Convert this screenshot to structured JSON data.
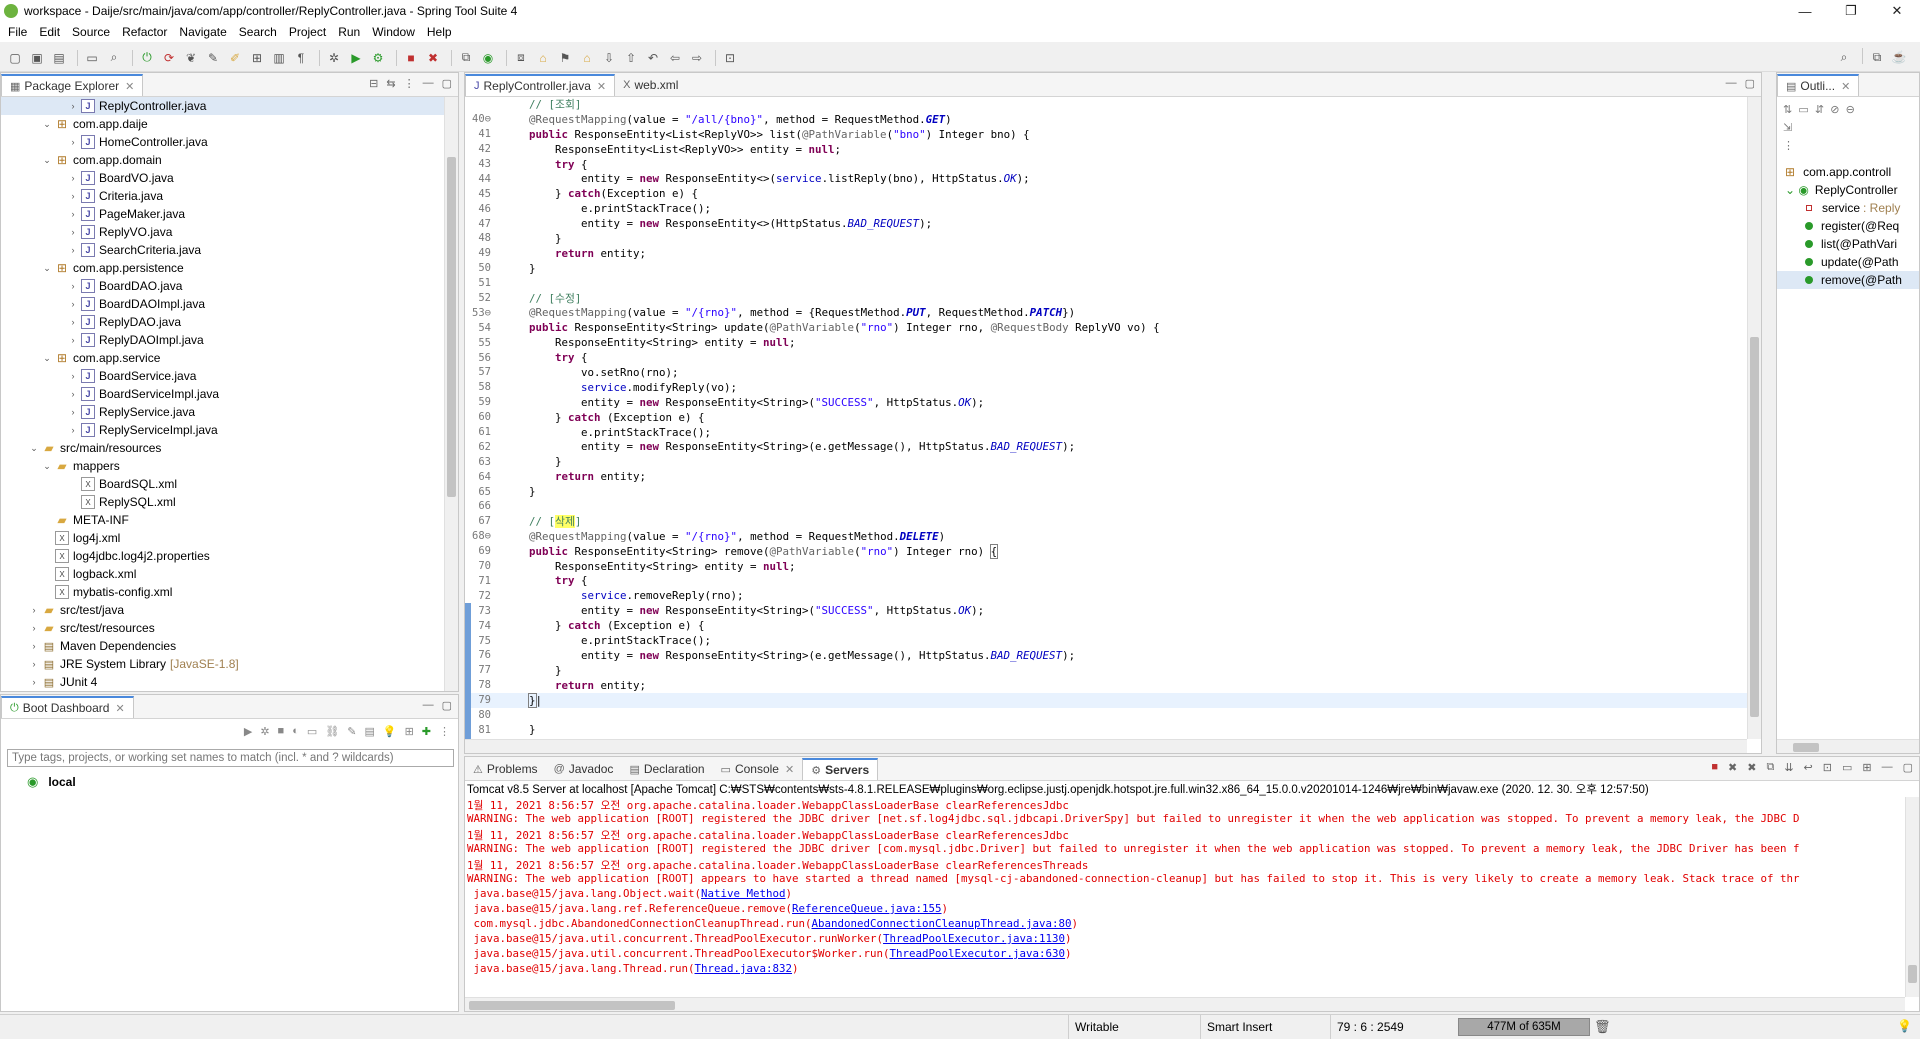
{
  "window": {
    "title": "workspace - Daije/src/main/java/com/app/controller/ReplyController.java - Spring Tool Suite 4",
    "controls": [
      "—",
      "❐",
      "✕"
    ]
  },
  "menu": [
    "File",
    "Edit",
    "Source",
    "Refactor",
    "Navigate",
    "Search",
    "Project",
    "Run",
    "Window",
    "Help"
  ],
  "package_explorer": {
    "tab": "Package Explorer",
    "rows": [
      {
        "indent": 4,
        "arrow": "›",
        "icon": "java",
        "label": "ReplyController.java",
        "selected": true
      },
      {
        "indent": 2,
        "arrow": "⌄",
        "icon": "pkg",
        "label": "com.app.daije"
      },
      {
        "indent": 4,
        "arrow": "›",
        "icon": "java",
        "label": "HomeController.java"
      },
      {
        "indent": 2,
        "arrow": "⌄",
        "icon": "pkg",
        "label": "com.app.domain"
      },
      {
        "indent": 4,
        "arrow": "›",
        "icon": "java",
        "label": "BoardVO.java"
      },
      {
        "indent": 4,
        "arrow": "›",
        "icon": "java",
        "label": "Criteria.java"
      },
      {
        "indent": 4,
        "arrow": "›",
        "icon": "java",
        "label": "PageMaker.java"
      },
      {
        "indent": 4,
        "arrow": "›",
        "icon": "java",
        "label": "ReplyVO.java"
      },
      {
        "indent": 4,
        "arrow": "›",
        "icon": "java",
        "label": "SearchCriteria.java"
      },
      {
        "indent": 2,
        "arrow": "⌄",
        "icon": "pkg",
        "label": "com.app.persistence"
      },
      {
        "indent": 4,
        "arrow": "›",
        "icon": "java",
        "label": "BoardDAO.java"
      },
      {
        "indent": 4,
        "arrow": "›",
        "icon": "java",
        "label": "BoardDAOImpl.java"
      },
      {
        "indent": 4,
        "arrow": "›",
        "icon": "java",
        "label": "ReplyDAO.java"
      },
      {
        "indent": 4,
        "arrow": "›",
        "icon": "java",
        "label": "ReplyDAOImpl.java"
      },
      {
        "indent": 2,
        "arrow": "⌄",
        "icon": "pkg",
        "label": "com.app.service"
      },
      {
        "indent": 4,
        "arrow": "›",
        "icon": "java",
        "label": "BoardService.java"
      },
      {
        "indent": 4,
        "arrow": "›",
        "icon": "java",
        "label": "BoardServiceImpl.java"
      },
      {
        "indent": 4,
        "arrow": "›",
        "icon": "java",
        "label": "ReplyService.java"
      },
      {
        "indent": 4,
        "arrow": "›",
        "icon": "java",
        "label": "ReplyServiceImpl.java"
      },
      {
        "indent": 1,
        "arrow": "⌄",
        "icon": "folder",
        "label": "src/main/resources"
      },
      {
        "indent": 2,
        "arrow": "⌄",
        "icon": "folder",
        "label": "mappers"
      },
      {
        "indent": 4,
        "arrow": "",
        "icon": "xml",
        "label": "BoardSQL.xml"
      },
      {
        "indent": 4,
        "arrow": "",
        "icon": "xml",
        "label": "ReplySQL.xml"
      },
      {
        "indent": 2,
        "arrow": "",
        "icon": "folder",
        "label": "META-INF"
      },
      {
        "indent": 2,
        "arrow": "",
        "icon": "xml",
        "label": "log4j.xml"
      },
      {
        "indent": 2,
        "arrow": "",
        "icon": "xml",
        "label": "log4jdbc.log4j2.properties"
      },
      {
        "indent": 2,
        "arrow": "",
        "icon": "xml",
        "label": "logback.xml"
      },
      {
        "indent": 2,
        "arrow": "",
        "icon": "xml",
        "label": "mybatis-config.xml"
      },
      {
        "indent": 1,
        "arrow": "›",
        "icon": "folder",
        "label": "src/test/java"
      },
      {
        "indent": 1,
        "arrow": "›",
        "icon": "folder",
        "label": "src/test/resources"
      },
      {
        "indent": 1,
        "arrow": "›",
        "icon": "lib",
        "label": "Maven Dependencies"
      },
      {
        "indent": 1,
        "arrow": "›",
        "icon": "lib",
        "label": "JRE System Library",
        "suffix": "[JavaSE-1.8]"
      },
      {
        "indent": 1,
        "arrow": "›",
        "icon": "lib",
        "label": "JUnit 4"
      }
    ]
  },
  "boot_dashboard": {
    "tab": "Boot Dashboard",
    "filter_placeholder": "Type tags, projects, or working set names to match (incl. * and ? wildcards)",
    "item": "local"
  },
  "editor": {
    "tabs": [
      "ReplyController.java",
      "web.xml"
    ],
    "lines": [
      {
        "n": "",
        "html": "<span class='cmt'>// [조회]</span>"
      },
      {
        "n": "40⊖",
        "html": "<span class='ann'>@RequestMapping</span>(value = <span class='str'>\"/all/{bno}\"</span>, method = RequestMethod.<span class='itl'><b>GET</b></span>)"
      },
      {
        "n": "41",
        "html": "<span class='kw'>public</span> ResponseEntity&lt;List&lt;ReplyVO&gt;&gt; list(<span class='ann'>@PathVariable</span>(<span class='str'>\"bno\"</span>) Integer bno) {"
      },
      {
        "n": "42",
        "html": "    ResponseEntity&lt;List&lt;ReplyVO&gt;&gt; entity = <span class='kw'>null</span>;"
      },
      {
        "n": "43",
        "html": "    <span class='kw'>try</span> {"
      },
      {
        "n": "44",
        "html": "        entity = <span class='kw'>new</span> ResponseEntity&lt;&gt;(<span class='fld'>service</span>.listReply(bno), HttpStatus.<span class='itl'>OK</span>);"
      },
      {
        "n": "45",
        "html": "    } <span class='kw'>catch</span>(Exception e) {"
      },
      {
        "n": "46",
        "html": "        e.printStackTrace();"
      },
      {
        "n": "47",
        "html": "        entity = <span class='kw'>new</span> ResponseEntity&lt;&gt;(HttpStatus.<span class='itl'>BAD_REQUEST</span>);"
      },
      {
        "n": "48",
        "html": "    }"
      },
      {
        "n": "49",
        "html": "    <span class='kw'>return</span> entity;"
      },
      {
        "n": "50",
        "html": "}"
      },
      {
        "n": "51",
        "html": ""
      },
      {
        "n": "52",
        "html": "<span class='cmt'>// [수정]</span>"
      },
      {
        "n": "53⊖",
        "html": "<span class='ann'>@RequestMapping</span>(value = <span class='str'>\"/{rno}\"</span>, method = {RequestMethod.<span class='itl'><b>PUT</b></span>, RequestMethod.<span class='itl'><b>PATCH</b></span>})"
      },
      {
        "n": "54",
        "html": "<span class='kw'>public</span> ResponseEntity&lt;String&gt; update(<span class='ann'>@PathVariable</span>(<span class='str'>\"rno\"</span>) Integer rno, <span class='ann'>@RequestBody</span> ReplyVO vo) {"
      },
      {
        "n": "55",
        "html": "    ResponseEntity&lt;String&gt; entity = <span class='kw'>null</span>;"
      },
      {
        "n": "56",
        "html": "    <span class='kw'>try</span> {"
      },
      {
        "n": "57",
        "html": "        vo.setRno(rno);"
      },
      {
        "n": "58",
        "html": "        <span class='fld'>service</span>.modifyReply(vo);"
      },
      {
        "n": "59",
        "html": "        entity = <span class='kw'>new</span> ResponseEntity&lt;String&gt;(<span class='str'>\"SUCCESS\"</span>, HttpStatus.<span class='itl'>OK</span>);"
      },
      {
        "n": "60",
        "html": "    } <span class='kw'>catch</span> (Exception e) {"
      },
      {
        "n": "61",
        "html": "        e.printStackTrace();"
      },
      {
        "n": "62",
        "html": "        entity = <span class='kw'>new</span> ResponseEntity&lt;String&gt;(e.getMessage(), HttpStatus.<span class='itl'>BAD_REQUEST</span>);"
      },
      {
        "n": "63",
        "html": "    }"
      },
      {
        "n": "64",
        "html": "    <span class='kw'>return</span> entity;"
      },
      {
        "n": "65",
        "html": "}"
      },
      {
        "n": "66",
        "html": ""
      },
      {
        "n": "67",
        "html": "<span class='cmt'>// [<span class='hl'>삭제</span>]</span>"
      },
      {
        "n": "68⊖",
        "html": "<span class='ann'>@RequestMapping</span>(value = <span class='str'>\"/{rno}\"</span>, method = RequestMethod.<span class='itl'><b>DELETE</b></span>)"
      },
      {
        "n": "69",
        "html": "<span class='kw'>public</span> ResponseEntity&lt;String&gt; remove(<span class='ann'>@PathVariable</span>(<span class='str'>\"rno\"</span>) Integer rno) <span style='outline:1px solid #808080'>{</span>"
      },
      {
        "n": "70",
        "html": "    ResponseEntity&lt;String&gt; entity = <span class='kw'>null</span>;"
      },
      {
        "n": "71",
        "html": "    <span class='kw'>try</span> {"
      },
      {
        "n": "72",
        "html": "        <span class='fld'>service</span>.removeReply(rno);"
      },
      {
        "n": "73",
        "html": "        entity = <span class='kw'>new</span> ResponseEntity&lt;String&gt;(<span class='str'>\"SUCCESS\"</span>, HttpStatus.<span class='itl'>OK</span>);"
      },
      {
        "n": "74",
        "html": "    } <span class='kw'>catch</span> (Exception e) {"
      },
      {
        "n": "75",
        "html": "        e.printStackTrace();"
      },
      {
        "n": "76",
        "html": "        entity = <span class='kw'>new</span> ResponseEntity&lt;String&gt;(e.getMessage(), HttpStatus.<span class='itl'>BAD_REQUEST</span>);"
      },
      {
        "n": "77",
        "html": "    }"
      },
      {
        "n": "78",
        "html": "    <span class='kw'>return</span> entity;"
      },
      {
        "n": "79",
        "html": "<span style='outline:1px solid #808080'>}</span>|",
        "current": true
      },
      {
        "n": "80",
        "html": ""
      },
      {
        "n": "81",
        "html": "}"
      }
    ]
  },
  "outline": {
    "tab": "Outli...",
    "rows": [
      {
        "indent": 1,
        "icon": "pkg",
        "label": "com.app.controll"
      },
      {
        "indent": 1,
        "icon": "class",
        "label": "ReplyController",
        "arrow": "⌄"
      },
      {
        "indent": 3,
        "icon": "field",
        "label": "service",
        "suffix": ": Reply"
      },
      {
        "indent": 3,
        "icon": "method",
        "label": "register(@Req"
      },
      {
        "indent": 3,
        "icon": "method",
        "label": "list(@PathVari"
      },
      {
        "indent": 3,
        "icon": "method",
        "label": "update(@Path"
      },
      {
        "indent": 3,
        "icon": "method",
        "label": "remove(@Path",
        "selected": true
      }
    ]
  },
  "bottom": {
    "tabs": [
      "Problems",
      "Javadoc",
      "Declaration",
      "Console",
      "Servers"
    ],
    "active_tab": "Servers",
    "server_header": "Tomcat v8.5 Server at localhost [Apache Tomcat] C:₩STS₩contents₩sts-4.8.1.RELEASE₩plugins₩org.eclipse.justj.openjdk.hotspot.jre.full.win32.x86_64_15.0.0.v20201014-1246₩jre₩bin₩javaw.exe  (2020. 12. 30. 오후 12:57:50)",
    "lines": [
      {
        "text": "1월 11, 2021 8:56:57 오전 org.apache.catalina.loader.WebappClassLoaderBase clearReferencesJdbc"
      },
      {
        "text": "WARNING: The web application [ROOT] registered the JDBC driver [net.sf.log4jdbc.sql.jdbcapi.DriverSpy] but failed to unregister it when the web application was stopped. To prevent a memory leak, the JDBC D"
      },
      {
        "text": "1월 11, 2021 8:56:57 오전 org.apache.catalina.loader.WebappClassLoaderBase clearReferencesJdbc"
      },
      {
        "text": "WARNING: The web application [ROOT] registered the JDBC driver [com.mysql.jdbc.Driver] but failed to unregister it when the web application was stopped. To prevent a memory leak, the JDBC Driver has been f"
      },
      {
        "text": "1월 11, 2021 8:56:57 오전 org.apache.catalina.loader.WebappClassLoaderBase clearReferencesThreads"
      },
      {
        "text": "WARNING: The web application [ROOT] appears to have started a thread named [mysql-cj-abandoned-connection-cleanup] but has failed to stop it. This is very likely to create a memory leak. Stack trace of thr"
      },
      {
        "text": " java.base@15/java.lang.Object.wait(",
        "link": "Native Method",
        "after": ")"
      },
      {
        "text": " java.base@15/java.lang.ref.ReferenceQueue.remove(",
        "link": "ReferenceQueue.java:155",
        "after": ")"
      },
      {
        "text": " com.mysql.jdbc.AbandonedConnectionCleanupThread.run(",
        "link": "AbandonedConnectionCleanupThread.java:80",
        "after": ")"
      },
      {
        "text": " java.base@15/java.util.concurrent.ThreadPoolExecutor.runWorker(",
        "link": "ThreadPoolExecutor.java:1130",
        "after": ")"
      },
      {
        "text": " java.base@15/java.util.concurrent.ThreadPoolExecutor$Worker.run(",
        "link": "ThreadPoolExecutor.java:630",
        "after": ")"
      },
      {
        "text": " java.base@15/java.lang.Thread.run(",
        "link": "Thread.java:832",
        "after": ")"
      }
    ]
  },
  "status": {
    "writable": "Writable",
    "insert": "Smart Insert",
    "position": "79 : 6 : 2549",
    "heap": "477M of 635M"
  }
}
